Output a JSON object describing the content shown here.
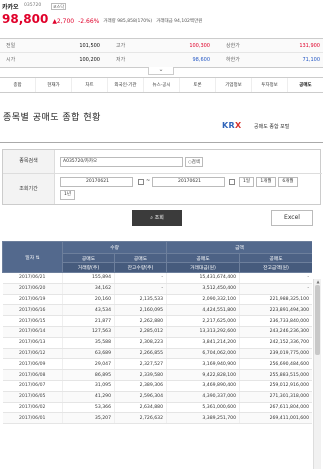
{
  "stock": {
    "name": "카카오",
    "code": "035720",
    "flag": "코스닥",
    "price": "98,800",
    "change": "▲2,700",
    "rate": "-2.66%",
    "volume": "거래량 985,858(170%)",
    "amount": "거래대금 94,102백만원",
    "quotes": [
      [
        {
          "label": "전일",
          "value": "101,500",
          "tone": ""
        },
        {
          "label": "고가",
          "value": "100,300",
          "tone": "red"
        },
        {
          "label": "상한가",
          "value": "131,900",
          "tone": "red"
        }
      ],
      [
        {
          "label": "시가",
          "value": "100,200",
          "tone": ""
        },
        {
          "label": "저가",
          "value": "98,600",
          "tone": "blue"
        },
        {
          "label": "하한가",
          "value": "71,100",
          "tone": "blue"
        }
      ]
    ]
  },
  "menu": [
    "종합",
    "현재가",
    "차트",
    "외국인·기관",
    "뉴스·공시",
    "토론",
    "기업정보",
    "투자정보",
    "공매도"
  ],
  "page": {
    "title": "종목별 공매도 종합 현황",
    "krx_a": "KR",
    "krx_b": "X",
    "krx_sub": "공매도 종합 포털"
  },
  "form": {
    "stock_label": "종목검색",
    "stock_value": "A035720/카카오",
    "search_mini": "검색",
    "period_label": "조회기간",
    "date_from": "20170621",
    "date_sep": "~",
    "date_to": "20170621",
    "p1": "1일",
    "p2": "1개월",
    "p3": "6개월",
    "p4": "1년",
    "search_button": "조회",
    "excel_button": "Excel"
  },
  "table": {
    "col_date": "일자",
    "group_volume": "수량",
    "group_amount": "금액",
    "h_volume_short": "공매도",
    "h_volume_short_sub": "거래량(주)",
    "h_volume_bal": "공매도",
    "h_volume_bal_sub": "잔고수량(주)",
    "h_amount_short": "공매도",
    "h_amount_short_sub": "거래대금(원)",
    "h_amount_bal": "공매도",
    "h_amount_bal_sub": "잔고금액(원)",
    "rows": [
      [
        "2017/06/21",
        "155,894",
        "-",
        "15,431,674,400",
        "-"
      ],
      [
        "2017/06/20",
        "34,162",
        "-",
        "3,512,450,400",
        "-"
      ],
      [
        "2017/06/19",
        "20,160",
        "2,135,533",
        "2,090,332,100",
        "221,988,325,100"
      ],
      [
        "2017/06/16",
        "43,534",
        "2,160,095",
        "4,424,551,800",
        "223,891,494,300"
      ],
      [
        "2017/06/15",
        "21,877",
        "2,262,880",
        "2,217,625,000",
        "236,733,840,000"
      ],
      [
        "2017/06/14",
        "127,563",
        "2,285,012",
        "13,313,292,600",
        "243,246,236,300"
      ],
      [
        "2017/06/13",
        "35,588",
        "2,308,223",
        "3,841,214,200",
        "242,152,336,700"
      ],
      [
        "2017/06/12",
        "63,689",
        "2,266,855",
        "6,704,062,000",
        "239,019,775,000"
      ],
      [
        "2017/06/09",
        "29,047",
        "2,327,527",
        "3,169,940,900",
        "256,690,484,600"
      ],
      [
        "2017/06/08",
        "86,895",
        "2,339,580",
        "9,422,828,100",
        "255,883,515,000"
      ],
      [
        "2017/06/07",
        "31,095",
        "2,389,306",
        "3,469,890,400",
        "259,012,916,000"
      ],
      [
        "2017/06/05",
        "41,290",
        "2,596,304",
        "4,390,337,000",
        "271,301,318,000"
      ],
      [
        "2017/06/02",
        "53,366",
        "2,634,880",
        "5,361,000,600",
        "267,611,804,000"
      ],
      [
        "2017/06/01",
        "35,207",
        "2,726,632",
        "3,389,251,700",
        "269,411,001,600"
      ]
    ]
  }
}
